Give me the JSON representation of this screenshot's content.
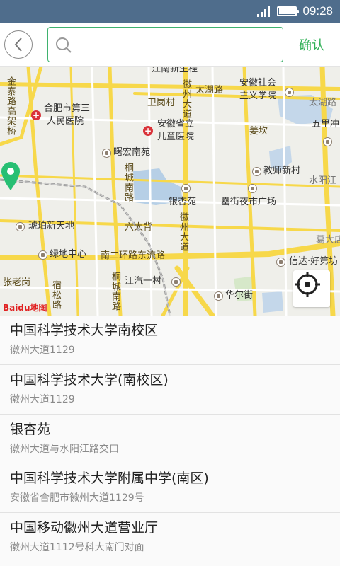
{
  "status_bar": {
    "time": "09:28"
  },
  "search": {
    "placeholder": "",
    "confirm_label": "确认"
  },
  "map": {
    "labels": {
      "jiangnan": "江南新生程",
      "jinzhai": "金寨路高架桥",
      "hefei_hospital": "合肥市第三人民医院",
      "hefei_hospital_1": "合肥市第三",
      "hefei_hospital_2": "人民医院",
      "weigang": "卫岗村",
      "children_hospital_1": "安徽省立",
      "children_hospital_2": "儿童医院",
      "huizhou_road_1": "徽州大道",
      "taihu_road": "太湖路",
      "socialism_1": "安徽社会",
      "socialism_2": "主义学院",
      "taihu_road_2": "太湖路",
      "wulichong": "五里冲",
      "jiangkan": "姜坎",
      "xuhong": "曙宏南苑",
      "tongcheng_road": "桐城南路",
      "teacher_village": "教师新村",
      "shuiyang": "水阳江",
      "yinxingyuan": "银杏苑",
      "nightmarket": "罍街夜市广场",
      "hupo": "琥珀新天地",
      "liudabei": "六大背",
      "huizhou_road_2": "徽州大道",
      "gewu": "葛大店",
      "lvdi": "绿地中心",
      "ring_road": "南二环路东流路",
      "xinda": "信达·好第坊",
      "zhanglaogang": "张老岗",
      "susong_road": "宿松路",
      "tongcheng_road_2": "桐城南路",
      "jianghuai": "江汽一村",
      "huaerjie": "华尔街"
    },
    "logo": "Baidu地图"
  },
  "results": [
    {
      "title": "中国科学技术大学南校区",
      "address": "徽州大道1129"
    },
    {
      "title": "中国科学技术大学(南校区)",
      "address": "徽州大道1129"
    },
    {
      "title": "银杏苑",
      "address": "徽州大道与水阳江路交口"
    },
    {
      "title": "中国科学技术大学附属中学(南区)",
      "address": "安徽省合肥市徽州大道1129号"
    },
    {
      "title": "中国移动徽州大道营业厅",
      "address": "徽州大道1112号科大南门对面"
    }
  ],
  "colors": {
    "accent": "#2fb055",
    "status_bar": "#4f6d8c",
    "pin": "#27bf73"
  }
}
